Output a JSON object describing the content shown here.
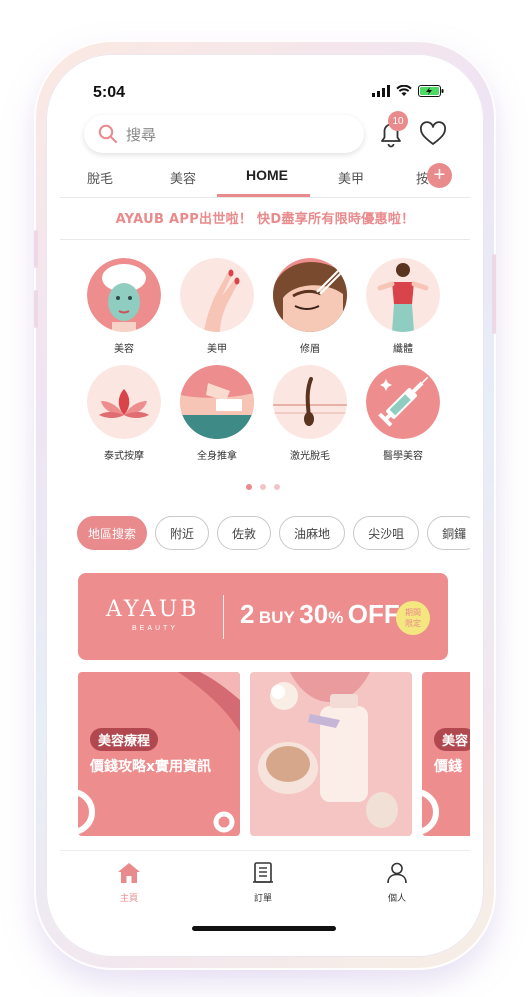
{
  "status_bar": {
    "time": "5:04"
  },
  "search": {
    "placeholder": "搜尋"
  },
  "notifications": {
    "count": "10"
  },
  "tabs": [
    {
      "label": "脫毛"
    },
    {
      "label": "美容"
    },
    {
      "label": "HOME",
      "active": true
    },
    {
      "label": "美甲"
    },
    {
      "label": "按"
    }
  ],
  "tabs_plus": "+",
  "promo": {
    "text": "AYAUB APP出世啦！ 快D盡享所有限時優惠啦！"
  },
  "categories": [
    {
      "label": "美容",
      "icon": "face-mask-icon"
    },
    {
      "label": "美甲",
      "icon": "manicure-hand-icon"
    },
    {
      "label": "修眉",
      "icon": "eyebrow-tweezer-icon"
    },
    {
      "label": "纖體",
      "icon": "body-slimming-icon"
    },
    {
      "label": "泰式按摩",
      "icon": "lotus-icon"
    },
    {
      "label": "全身推拿",
      "icon": "massage-hands-icon"
    },
    {
      "label": "激光脫毛",
      "icon": "hair-follicle-icon"
    },
    {
      "label": "醫學美容",
      "icon": "syringe-icon"
    }
  ],
  "pager": {
    "pages": 3,
    "current": 0
  },
  "chips": [
    {
      "label": "地區搜索",
      "active": true
    },
    {
      "label": "附近"
    },
    {
      "label": "佐敦"
    },
    {
      "label": "油麻地"
    },
    {
      "label": "尖沙咀"
    },
    {
      "label": "銅鑼"
    }
  ],
  "sale_banner": {
    "brand": "AYAUB",
    "brand_sub": "BEAUTY",
    "sale_num": "2",
    "sale_buy": "BUY",
    "sale_pct": "30",
    "sale_pct_sign": "%",
    "sale_off": "OFF",
    "pill_line1": "期間",
    "pill_line2": "限定"
  },
  "cards": [
    {
      "tag": "美容療程",
      "title": "價錢攻略x實用資訊"
    },
    {
      "tag": "",
      "title": ""
    },
    {
      "tag": "美容",
      "title": "價錢"
    }
  ],
  "bottom_nav": [
    {
      "label": "主頁",
      "icon": "home-icon",
      "active": true
    },
    {
      "label": "訂單",
      "icon": "order-list-icon"
    },
    {
      "label": "個人",
      "icon": "person-icon"
    }
  ],
  "colors": {
    "accent": "#e98a8c",
    "banner": "#ee8d8e",
    "tag_dark": "#b14850",
    "pill_yellow": "#f4e77f"
  }
}
